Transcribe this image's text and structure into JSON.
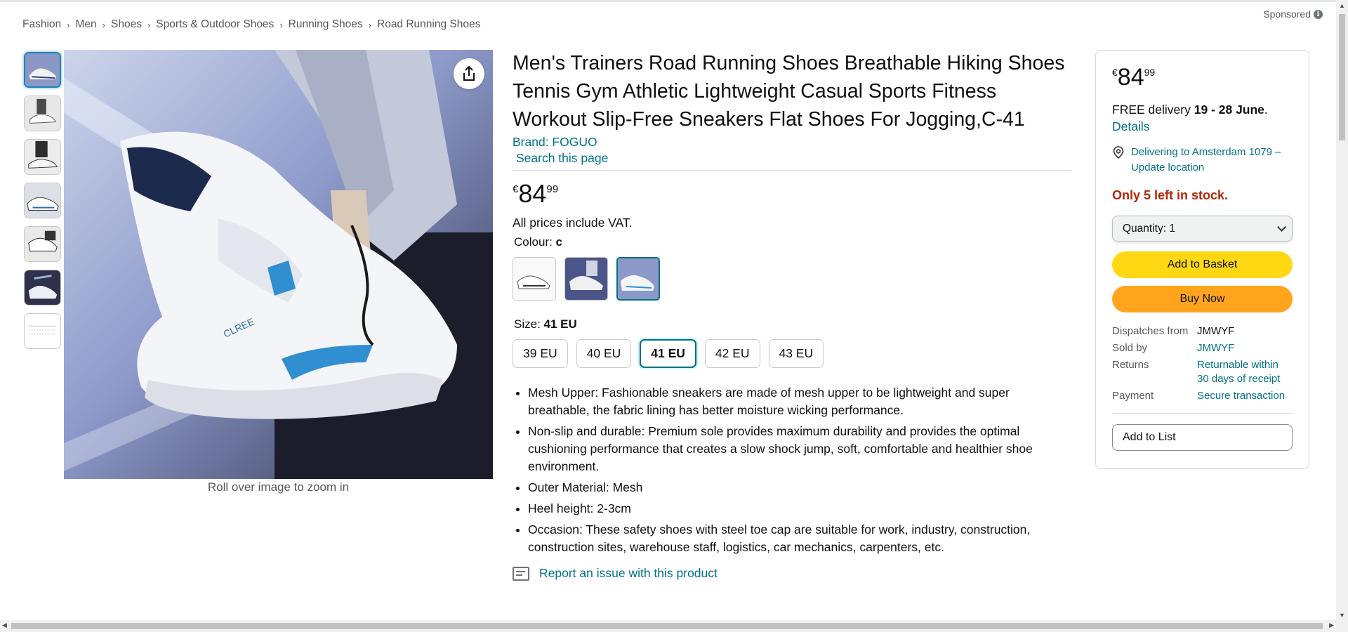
{
  "breadcrumb": [
    "Fashion",
    "Men",
    "Shoes",
    "Sports & Outdoor Shoes",
    "Running Shoes",
    "Road Running Shoes"
  ],
  "breadcrumb_separator": "›",
  "sponsored": "Sponsored",
  "info_glyph": "i",
  "gallery": {
    "thumbnail_count": 7,
    "active_index": 0,
    "zoom_hint": "Roll over image to zoom in"
  },
  "product": {
    "title": "Men's Trainers Road Running Shoes Breathable Hiking Shoes Tennis Gym Athletic Lightweight Casual Sports Fitness Workout Slip-Free Sneakers Flat Shoes For Jogging,C-41",
    "brand": "Brand: FOGUO",
    "search_page": "Search this page",
    "price": {
      "currency": "€",
      "whole": "84",
      "fraction": "99"
    },
    "vat_note": "All prices include VAT.",
    "colour_label": "Colour:",
    "colour_value": "c",
    "colour_options": 3,
    "colour_selected_index": 2,
    "size_label": "Size:",
    "size_value": "41 EU",
    "sizes": [
      "39 EU",
      "40 EU",
      "41 EU",
      "42 EU",
      "43 EU"
    ],
    "size_selected_index": 2,
    "bullets": [
      "Mesh Upper: Fashionable sneakers are made of mesh upper to be lightweight and super breathable, the fabric lining has better moisture wicking performance.",
      "Non-slip and durable: Premium sole provides maximum durability and provides the optimal cushioning performance that creates a slow shock jump, soft, comfortable and healthier shoe environment.",
      "Outer Material: Mesh",
      "Heel height: 2-3cm",
      "Occasion: These safety shoes with steel toe cap are suitable for work, industry, construction, construction sites, warehouse staff, logistics, car mechanics, carpenters, etc."
    ],
    "report_link": "Report an issue with this product"
  },
  "buybox": {
    "price": {
      "currency": "€",
      "whole": "84",
      "fraction": "99"
    },
    "delivery_prefix": "FREE delivery",
    "delivery_dates": "19 - 28 June",
    "delivery_suffix": ".",
    "details_link": "Details",
    "location": "Delivering to Amsterdam 1079 – Update location",
    "stock": "Only 5 left in stock.",
    "quantity_label": "Quantity:",
    "quantity_value": "1",
    "add_to_basket": "Add to Basket",
    "buy_now": "Buy Now",
    "info": [
      {
        "key": "Dispatches from",
        "value": "JMWYF",
        "link": false
      },
      {
        "key": "Sold by",
        "value": "JMWYF",
        "link": true
      },
      {
        "key": "Returns",
        "value": "Returnable within 30 days of receipt",
        "link": true
      },
      {
        "key": "Payment",
        "value": "Secure transaction",
        "link": true
      }
    ],
    "add_to_list": "Add to List"
  },
  "colors": {
    "link": "#007185",
    "stock_red": "#b12704",
    "basket_yellow": "#ffd814",
    "buy_orange": "#ffa41c"
  }
}
